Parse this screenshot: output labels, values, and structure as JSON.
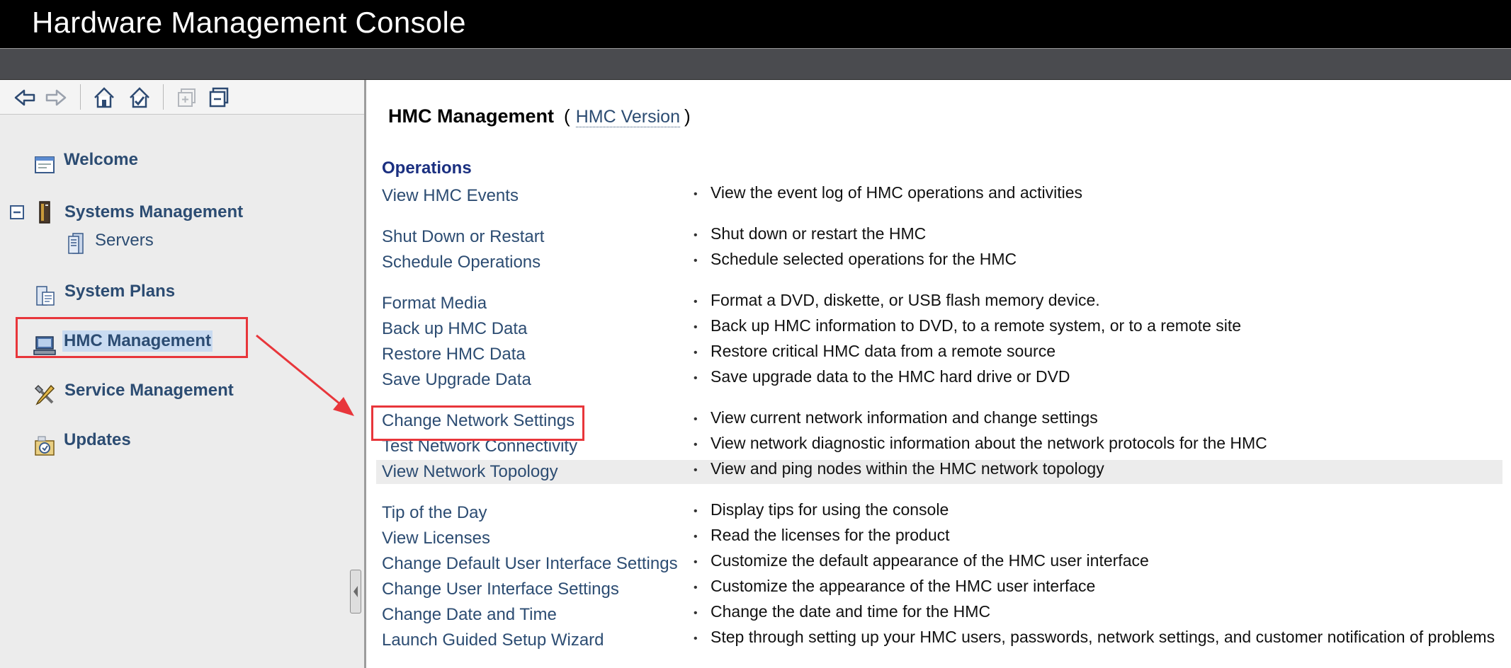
{
  "app": {
    "title": "Hardware Management Console"
  },
  "colors": {
    "title_bar": "#000000",
    "menu_bar": "#4a4b4f",
    "nav_background": "#ececec",
    "link": "#2c4c72",
    "section_heading": "#1a2f80",
    "annotation_red": "#e8363b",
    "selected_highlight": "#c9dbf1"
  },
  "toolbar": {
    "icons": [
      "back-arrow-icon",
      "forward-arrow-icon",
      "home-icon",
      "favorites-icon",
      "expand-all-icon",
      "collapse-all-icon"
    ]
  },
  "nav": {
    "items": [
      {
        "label": "Welcome",
        "icon": "welcome-window-icon"
      },
      {
        "label": "Systems Management",
        "icon": "server-rack-icon",
        "expanded": true,
        "children": [
          {
            "label": "Servers",
            "icon": "servers-icon"
          }
        ]
      },
      {
        "label": "System Plans",
        "icon": "system-plans-icon"
      },
      {
        "label": "HMC Management",
        "icon": "hmc-computer-icon",
        "selected": true
      },
      {
        "label": "Service Management",
        "icon": "service-tools-icon"
      },
      {
        "label": "Updates",
        "icon": "updates-icon"
      }
    ]
  },
  "main": {
    "title": "HMC Management",
    "open_paren": "(",
    "version_link": "HMC Version",
    "close_paren": ")",
    "section": "Operations",
    "operations": [
      {
        "link": "View HMC Events",
        "desc": "View the event log of HMC operations and activities"
      },
      {
        "link": "Shut Down or Restart",
        "desc": "Shut down or restart the HMC"
      },
      {
        "link": "Schedule Operations",
        "desc": "Schedule selected operations for the HMC"
      },
      {
        "link": "Format Media",
        "desc": "Format a DVD, diskette, or USB flash memory device."
      },
      {
        "link": "Back up HMC Data",
        "desc": "Back up HMC information to DVD, to a remote system, or to a remote site"
      },
      {
        "link": "Restore HMC Data",
        "desc": "Restore critical HMC data from a remote source"
      },
      {
        "link": "Save Upgrade Data",
        "desc": "Save upgrade data to the HMC hard drive or DVD"
      },
      {
        "link": "Change Network Settings",
        "desc": "View current network information and change settings"
      },
      {
        "link": "Test Network Connectivity",
        "desc": "View network diagnostic information about the network protocols for the HMC"
      },
      {
        "link": "View Network Topology",
        "desc": "View and ping nodes within the HMC network topology"
      },
      {
        "link": "Tip of the Day",
        "desc": "Display tips for using the console"
      },
      {
        "link": "View Licenses",
        "desc": "Read the licenses for the product"
      },
      {
        "link": "Change Default User Interface Settings",
        "desc": "Customize the default appearance of the HMC user interface"
      },
      {
        "link": "Change User Interface Settings",
        "desc": "Customize the appearance of the HMC user interface"
      },
      {
        "link": "Change Date and Time",
        "desc": "Change the date and time for the HMC"
      },
      {
        "link": "Launch Guided Setup Wizard",
        "desc": "Step through setting up your HMC users, passwords, network settings, and customer notification of problems"
      }
    ]
  }
}
